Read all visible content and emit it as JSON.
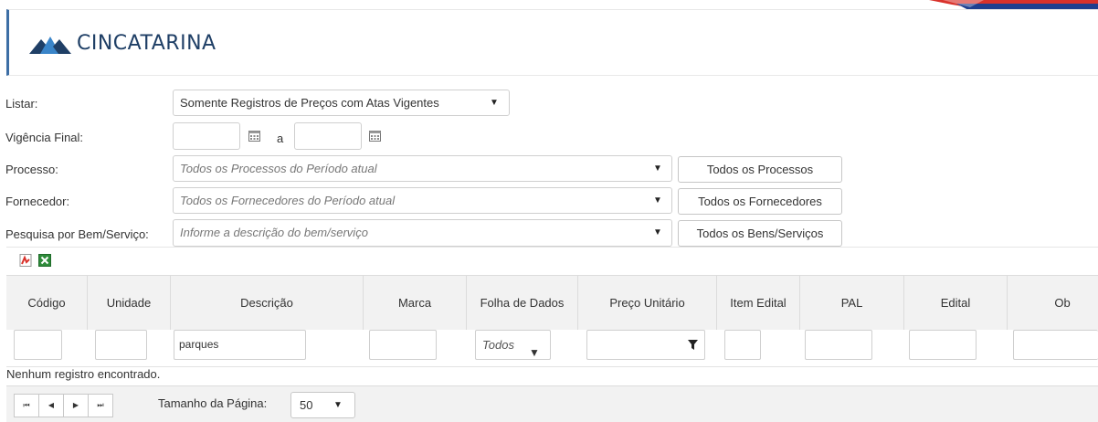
{
  "header": {
    "logo_text": "CINCATARINA",
    "brand_colors": {
      "navy": "#1f3f66",
      "blue": "#3a85c9",
      "red": "#d9322b"
    }
  },
  "form": {
    "listar": {
      "label": "Listar:",
      "value": "Somente Registros de Preços com Atas Vigentes"
    },
    "vigencia": {
      "label": "Vigência Final:",
      "from": "",
      "separator": "a",
      "to": ""
    },
    "processo": {
      "label": "Processo:",
      "placeholder": "Todos os Processos do Período atual",
      "button": "Todos os Processos"
    },
    "fornecedor": {
      "label": "Fornecedor:",
      "placeholder": "Todos os Fornecedores do Período atual",
      "button": "Todos os Fornecedores"
    },
    "bem": {
      "label": "Pesquisa por Bem/Serviço:",
      "placeholder": "Informe a descrição do bem/serviço",
      "button": "Todos os Bens/Serviços"
    }
  },
  "grid": {
    "export_icons": [
      "pdf-export-icon",
      "excel-export-icon"
    ],
    "columns": [
      "Código",
      "Unidade",
      "Descrição",
      "Marca",
      "Folha de Dados",
      "Preço Unitário",
      "Item Edital",
      "PAL",
      "Edital",
      "Ob"
    ],
    "filters": {
      "codigo": "",
      "unidade": "",
      "descricao": "parques",
      "marca": "",
      "folha_dados": "Todos",
      "preco": "",
      "item_edital": "",
      "pal": "",
      "edital": "",
      "ob": ""
    },
    "empty_message": "Nenhum registro encontrado."
  },
  "pager": {
    "page_size_label": "Tamanho da Página:",
    "page_size": "50"
  }
}
